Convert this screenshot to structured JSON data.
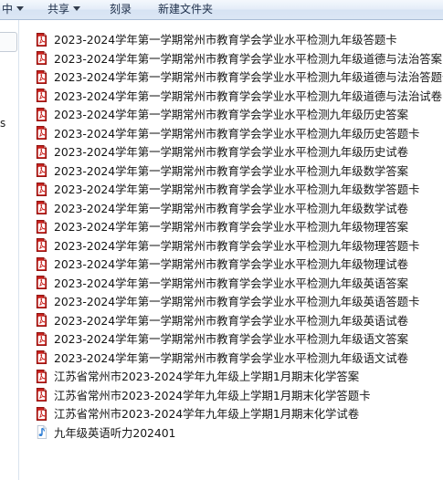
{
  "toolbar": {
    "partial_item": "中",
    "share_label": "共享",
    "burn_label": "刻录",
    "new_folder_label": "新建文件夹"
  },
  "navpane": {
    "partial_letter": "s"
  },
  "files": [
    {
      "name": "2023-2024学年第一学期常州市教育学会学业水平检测九年级答题卡",
      "icon": "pdf-icon"
    },
    {
      "name": "2023-2024学年第一学期常州市教育学会学业水平检测九年级道德与法治答案",
      "icon": "pdf-icon"
    },
    {
      "name": "2023-2024学年第一学期常州市教育学会学业水平检测九年级道德与法治答题卡",
      "icon": "pdf-icon"
    },
    {
      "name": "2023-2024学年第一学期常州市教育学会学业水平检测九年级道德与法治试卷",
      "icon": "pdf-icon"
    },
    {
      "name": "2023-2024学年第一学期常州市教育学会学业水平检测九年级历史答案",
      "icon": "pdf-icon"
    },
    {
      "name": "2023-2024学年第一学期常州市教育学会学业水平检测九年级历史答题卡",
      "icon": "pdf-icon"
    },
    {
      "name": "2023-2024学年第一学期常州市教育学会学业水平检测九年级历史试卷",
      "icon": "pdf-icon"
    },
    {
      "name": "2023-2024学年第一学期常州市教育学会学业水平检测九年级数学答案",
      "icon": "pdf-icon"
    },
    {
      "name": "2023-2024学年第一学期常州市教育学会学业水平检测九年级数学答题卡",
      "icon": "pdf-icon"
    },
    {
      "name": "2023-2024学年第一学期常州市教育学会学业水平检测九年级数学试卷",
      "icon": "pdf-icon"
    },
    {
      "name": "2023-2024学年第一学期常州市教育学会学业水平检测九年级物理答案",
      "icon": "pdf-icon"
    },
    {
      "name": "2023-2024学年第一学期常州市教育学会学业水平检测九年级物理答题卡",
      "icon": "pdf-icon"
    },
    {
      "name": "2023-2024学年第一学期常州市教育学会学业水平检测九年级物理试卷",
      "icon": "pdf-icon"
    },
    {
      "name": "2023-2024学年第一学期常州市教育学会学业水平检测九年级英语答案",
      "icon": "pdf-icon"
    },
    {
      "name": "2023-2024学年第一学期常州市教育学会学业水平检测九年级英语答题卡",
      "icon": "pdf-icon"
    },
    {
      "name": "2023-2024学年第一学期常州市教育学会学业水平检测九年级英语试卷",
      "icon": "pdf-icon"
    },
    {
      "name": "2023-2024学年第一学期常州市教育学会学业水平检测九年级语文答案",
      "icon": "pdf-icon"
    },
    {
      "name": "2023-2024学年第一学期常州市教育学会学业水平检测九年级语文试卷",
      "icon": "pdf-icon"
    },
    {
      "name": "江苏省常州市2023-2024学年九年级上学期1月期末化学答案",
      "icon": "pdf-icon"
    },
    {
      "name": "江苏省常州市2023-2024学年九年级上学期1月期末化学答题卡",
      "icon": "pdf-icon"
    },
    {
      "name": "江苏省常州市2023-2024学年九年级上学期1月期末化学试卷",
      "icon": "pdf-icon"
    },
    {
      "name": "九年级英语听力202401",
      "icon": "audio-file-icon"
    }
  ],
  "colors": {
    "pdf_red": "#c8201c",
    "audio_blue": "#2f7fd6"
  }
}
